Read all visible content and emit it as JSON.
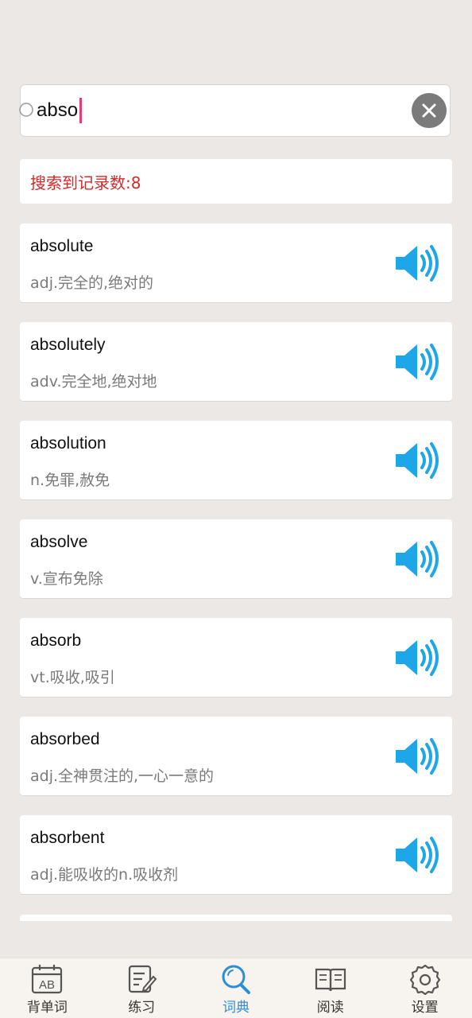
{
  "search": {
    "value": "abso"
  },
  "result": {
    "record_count_text": "搜索到记录数:8"
  },
  "words": [
    {
      "term": "absolute",
      "definition": "adj.完全的,绝对的"
    },
    {
      "term": "absolutely",
      "definition": "adv.完全地,绝对地"
    },
    {
      "term": "absolution",
      "definition": "n.免罪,赦免"
    },
    {
      "term": "absolve",
      "definition": "v.宣布免除"
    },
    {
      "term": "absorb",
      "definition": "vt.吸收,吸引"
    },
    {
      "term": "absorbed",
      "definition": "adj.全神贯注的,一心一意的"
    },
    {
      "term": "absorbent",
      "definition": "adj.能吸收的n.吸收剂"
    }
  ],
  "nav": {
    "items": [
      {
        "label": "背单词",
        "icon": "ab-calendar-icon"
      },
      {
        "label": "练习",
        "icon": "edit-note-icon"
      },
      {
        "label": "词典",
        "icon": "search-icon",
        "active": true
      },
      {
        "label": "阅读",
        "icon": "open-book-icon"
      },
      {
        "label": "设置",
        "icon": "gear-icon"
      }
    ]
  },
  "colors": {
    "background": "#ece8e5",
    "accent_blue": "#2b8fd6",
    "speaker_blue": "#1ea7e8",
    "count_red": "#d12b2b",
    "caret_pink": "#e0407a"
  }
}
